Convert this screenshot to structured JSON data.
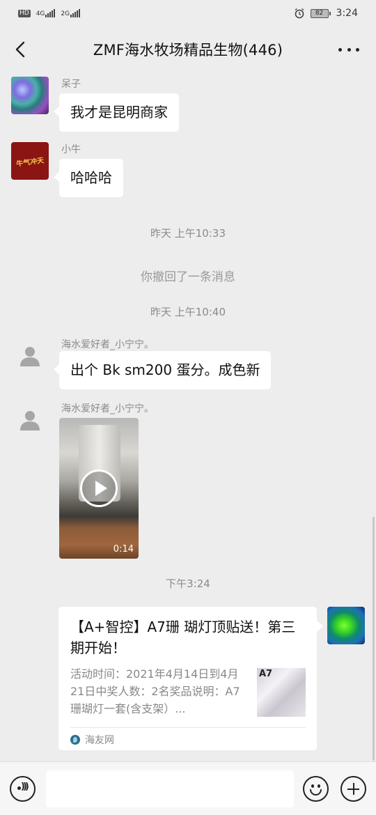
{
  "status_bar": {
    "hd_tag": "HD",
    "net1": "4G",
    "net2": "2G",
    "battery": "82",
    "time": "3:24"
  },
  "header": {
    "title": "ZMF海水牧场精品生物(446)"
  },
  "messages": [
    {
      "sender": "呆子",
      "text": "我才是昆明商家",
      "avatar": "coral-photo"
    },
    {
      "sender": "小牛",
      "text": "哈哈哈",
      "avatar_text": "牛气冲天"
    },
    {
      "sender": "海水爱好者_小宁宁。",
      "text": "出个 Bk sm200 蛋分。成色新",
      "avatar": "default-user"
    },
    {
      "sender": "海水爱好者_小宁宁。",
      "video_duration": "0:14",
      "avatar": "default-user"
    }
  ],
  "timestamps": {
    "t1": "昨天 上午10:33",
    "t2": "昨天 上午10:40",
    "t3": "下午3:24"
  },
  "recall_notice": "你撤回了一条消息",
  "link_card": {
    "title": "【A+智控】A7珊 瑚灯顶贴送！第三期开始！",
    "description": "活动时间：2021年4月14日到4月21日中奖人数：2名奖品说明：A7珊瑚灯一套(含支架）...",
    "thumb_label": "A7",
    "source": "海友网"
  },
  "colors": {
    "chat_bg": "#ededed",
    "bubble": "#ffffff",
    "meta_text": "#8a8a8a"
  }
}
